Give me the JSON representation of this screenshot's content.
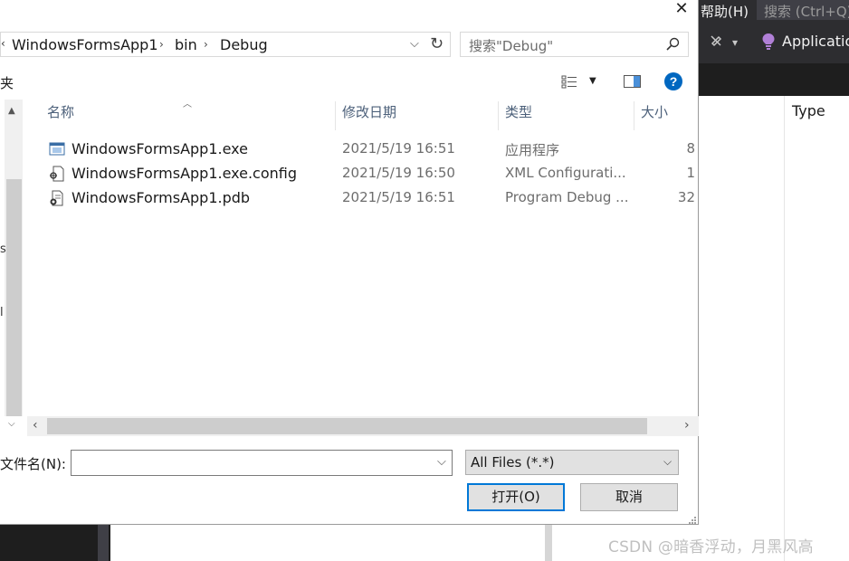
{
  "background": {
    "menu_help": "帮助(H)",
    "search_placeholder": "搜索 (Ctrl+Q)",
    "toolbar_label": "Applicatio",
    "panel_header_type": "Type",
    "watermark": "CSDN @暗香浮动，月黑风高"
  },
  "dialog": {
    "close_label": "✕",
    "address": {
      "crumbs": [
        "WindowsFormsApp1",
        "bin",
        "Debug"
      ]
    },
    "search": {
      "placeholder": "搜索\"Debug\""
    },
    "commandbar": {
      "left_fragment": "夹"
    },
    "nav_fragments": [
      "s",
      "l"
    ],
    "columns": {
      "name": "名称",
      "date": "修改日期",
      "type": "类型",
      "size": "大小"
    },
    "files": [
      {
        "name": "WindowsFormsApp1.exe",
        "date": "2021/5/19 16:51",
        "type": "应用程序",
        "size": "8",
        "icon": "exe-icon"
      },
      {
        "name": "WindowsFormsApp1.exe.config",
        "date": "2021/5/19 16:50",
        "type": "XML Configurati...",
        "size": "1",
        "icon": "config-file-icon"
      },
      {
        "name": "WindowsFormsApp1.pdb",
        "date": "2021/5/19 16:51",
        "type": "Program Debug ...",
        "size": "32",
        "icon": "pdb-file-icon"
      }
    ],
    "filename": {
      "label": "文件名(N):",
      "value": ""
    },
    "filter": {
      "selected": "All Files (*.*)"
    },
    "buttons": {
      "open": "打开(O)",
      "cancel": "取消"
    }
  }
}
